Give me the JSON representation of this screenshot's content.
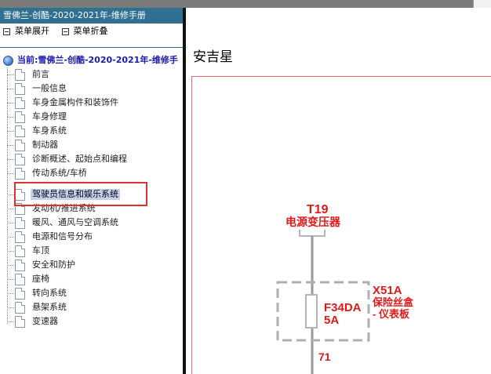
{
  "sidebar": {
    "title": "雪佛兰-创酷-2020-2021年-维修手册",
    "expand_label": "菜单展开",
    "collapse_label": "菜单折叠",
    "root_label": "当前:雪佛兰-创酷-2020-2021年-维修手",
    "items": [
      {
        "label": "前言"
      },
      {
        "label": "一般信息"
      },
      {
        "label": "车身金属构件和装饰件"
      },
      {
        "label": "车身修理"
      },
      {
        "label": "车身系统"
      },
      {
        "label": "制动器"
      },
      {
        "label": "诊断概述、起始点和编程"
      },
      {
        "label": "传动系统/车桥"
      },
      {
        "label": "驾驶员信息和娱乐系统",
        "selected": true
      },
      {
        "label": "发动机/推进系统"
      },
      {
        "label": "暖风、通风与空调系统"
      },
      {
        "label": "电源和信号分布"
      },
      {
        "label": "车顶"
      },
      {
        "label": "安全和防护"
      },
      {
        "label": "座椅"
      },
      {
        "label": "转向系统"
      },
      {
        "label": "悬架系统"
      },
      {
        "label": "变速器"
      }
    ]
  },
  "main": {
    "title": "安吉星"
  },
  "diagram": {
    "connector_top_id": "T19",
    "connector_top_name": "电源变压器",
    "fuse_id": "F34DA",
    "fuse_rating": "5A",
    "fuse_box_id": "X51A",
    "fuse_box_name_line1": "保险丝盒",
    "fuse_box_name_line2": "- 仪表板",
    "wire_number": "71"
  },
  "colors": {
    "title_bar": "#2f6f91",
    "diagram_label": "#e01a1a",
    "highlight_box": "#e03030",
    "selection": "#c6d3e6"
  }
}
